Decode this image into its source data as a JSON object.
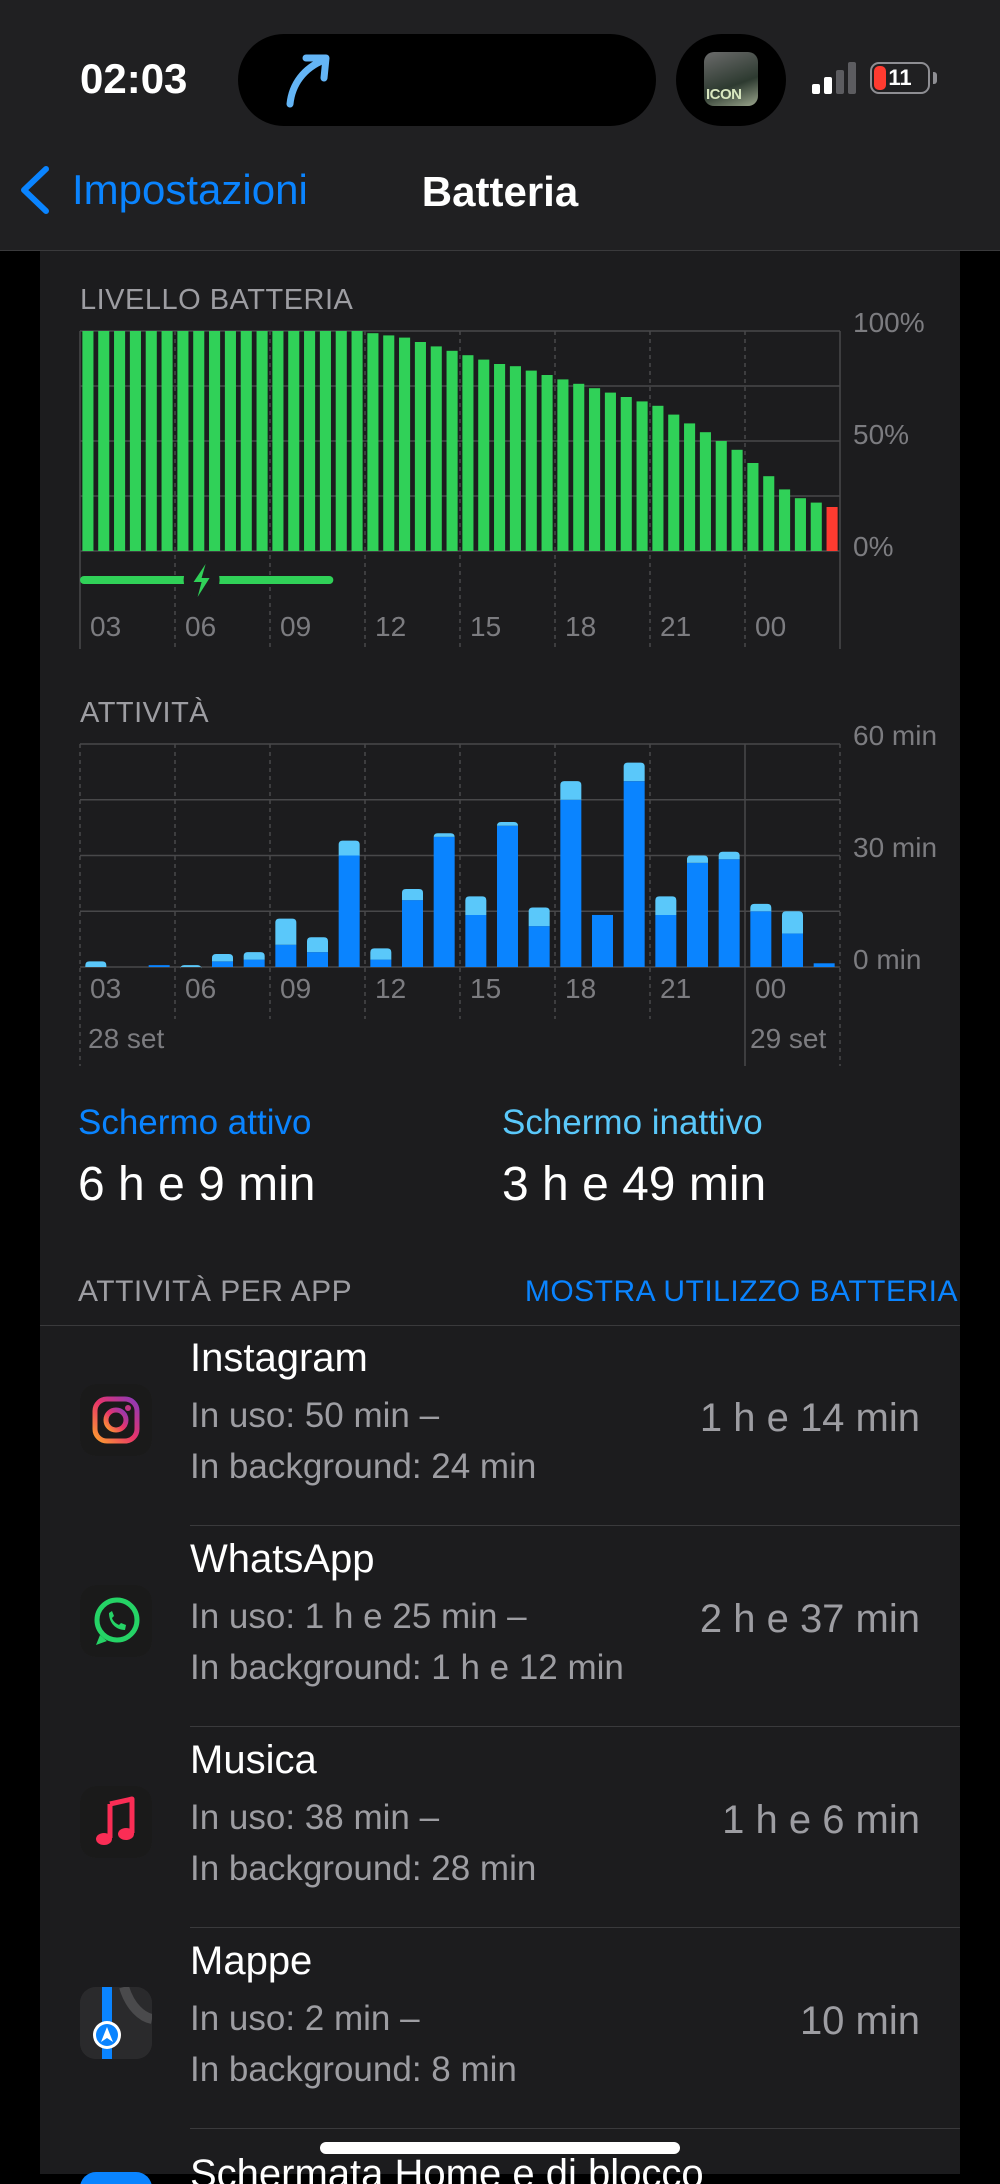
{
  "status_bar": {
    "time": "02:03",
    "battery_level": "11",
    "album_art_text": "ICON"
  },
  "nav": {
    "back_label": "Impostazioni",
    "title": "Batteria"
  },
  "battery_chart": {
    "label": "LIVELLO BATTERIA",
    "y_labels": [
      "100%",
      "50%",
      "0%"
    ],
    "x_labels": [
      "03",
      "06",
      "09",
      "12",
      "15",
      "18",
      "21",
      "00"
    ]
  },
  "activity_chart": {
    "label": "ATTIVITÀ",
    "y_labels": [
      "60 min",
      "30 min",
      "0 min"
    ],
    "x_labels": [
      "03",
      "06",
      "09",
      "12",
      "15",
      "18",
      "21",
      "00"
    ],
    "date_left": "28 set",
    "date_right": "29 set"
  },
  "chart_data": [
    {
      "type": "bar",
      "title": "LIVELLO BATTERIA",
      "x_unit": "hour of day (from 02:00 on 28 set)",
      "ylim": [
        0,
        100
      ],
      "y_unit": "%",
      "charging_interval_hours": [
        2.0,
        10.0
      ],
      "colors": {
        "normal": "#30d158",
        "low": "#ff3b30"
      },
      "low_threshold_percent": 20,
      "series": [
        {
          "x_hours": [
            2.0,
            2.5,
            3.0,
            3.5,
            4.0,
            4.5,
            5.0,
            5.5,
            6.0,
            6.5,
            7.0,
            7.5,
            8.0,
            8.5,
            9.0,
            9.5,
            10.0,
            10.5,
            11.0,
            11.5,
            12.0,
            12.5,
            13.0,
            13.5,
            14.0,
            14.5,
            15.0,
            15.5,
            16.0,
            16.5,
            17.0,
            17.5,
            18.0,
            18.5,
            19.0,
            19.5,
            20.0,
            20.5,
            21.0,
            21.5,
            22.0,
            22.5,
            23.0,
            23.5,
            24.0,
            24.5,
            25.0,
            25.5
          ],
          "values": [
            100,
            100,
            100,
            100,
            100,
            100,
            100,
            100,
            100,
            100,
            100,
            100,
            100,
            100,
            100,
            100,
            100,
            100,
            99,
            98,
            97,
            95,
            93,
            91,
            89,
            87,
            85,
            84,
            82,
            80,
            78,
            76,
            74,
            72,
            70,
            68,
            66,
            62,
            58,
            54,
            50,
            46,
            40,
            34,
            28,
            24,
            22,
            20
          ]
        }
      ]
    },
    {
      "type": "bar",
      "title": "ATTIVITÀ",
      "stacked": true,
      "ylim": [
        0,
        60
      ],
      "y_unit": "min",
      "categories": [
        "02",
        "03",
        "04",
        "05",
        "06",
        "07",
        "08",
        "09",
        "10",
        "11",
        "12",
        "13",
        "14",
        "15",
        "16",
        "17",
        "18",
        "19",
        "20",
        "21",
        "22",
        "23",
        "00",
        "01"
      ],
      "series": [
        {
          "name": "Schermo attivo",
          "color": "#0a84ff",
          "values": [
            0,
            0,
            0.5,
            0,
            1.5,
            2,
            6,
            4,
            30,
            2,
            18,
            35,
            14,
            38,
            11,
            45,
            14,
            50,
            14,
            28,
            29,
            15,
            9,
            1
          ]
        },
        {
          "name": "Schermo inattivo",
          "color": "#5ac8fa",
          "values": [
            1.5,
            0,
            0,
            0.5,
            2,
            2,
            7,
            4,
            4,
            3,
            3,
            1,
            5,
            1,
            5,
            5,
            0,
            5,
            5,
            2,
            2,
            2,
            6,
            0
          ]
        }
      ]
    }
  ],
  "stats": {
    "screen_on_label": "Schermo attivo",
    "screen_on_value": "6 h e 9 min",
    "screen_off_label": "Schermo inattivo",
    "screen_off_value": "3 h e 49 min"
  },
  "app_activity": {
    "header": "ATTIVITÀ PER APP",
    "action": "MOSTRA UTILIZZO BATTERIA",
    "apps": [
      {
        "name": "Instagram",
        "detail1": "In uso: 50 min –",
        "detail2": "In background: 24 min",
        "total": "1 h e 14 min",
        "icon": "instagram-icon"
      },
      {
        "name": "WhatsApp",
        "detail1": "In uso: 1 h e 25 min –",
        "detail2": "In background: 1 h e 12 min",
        "total": "2 h e 37 min",
        "icon": "whatsapp-icon"
      },
      {
        "name": "Musica",
        "detail1": "In uso: 38 min –",
        "detail2": "In background: 28 min",
        "total": "1 h e 6 min",
        "icon": "music-icon"
      },
      {
        "name": "Mappe",
        "detail1": "In uso: 2 min –",
        "detail2": "In background: 8 min",
        "total": "10 min",
        "icon": "maps-icon"
      }
    ],
    "partial_app_name": "Schermata Home e di blocco"
  }
}
